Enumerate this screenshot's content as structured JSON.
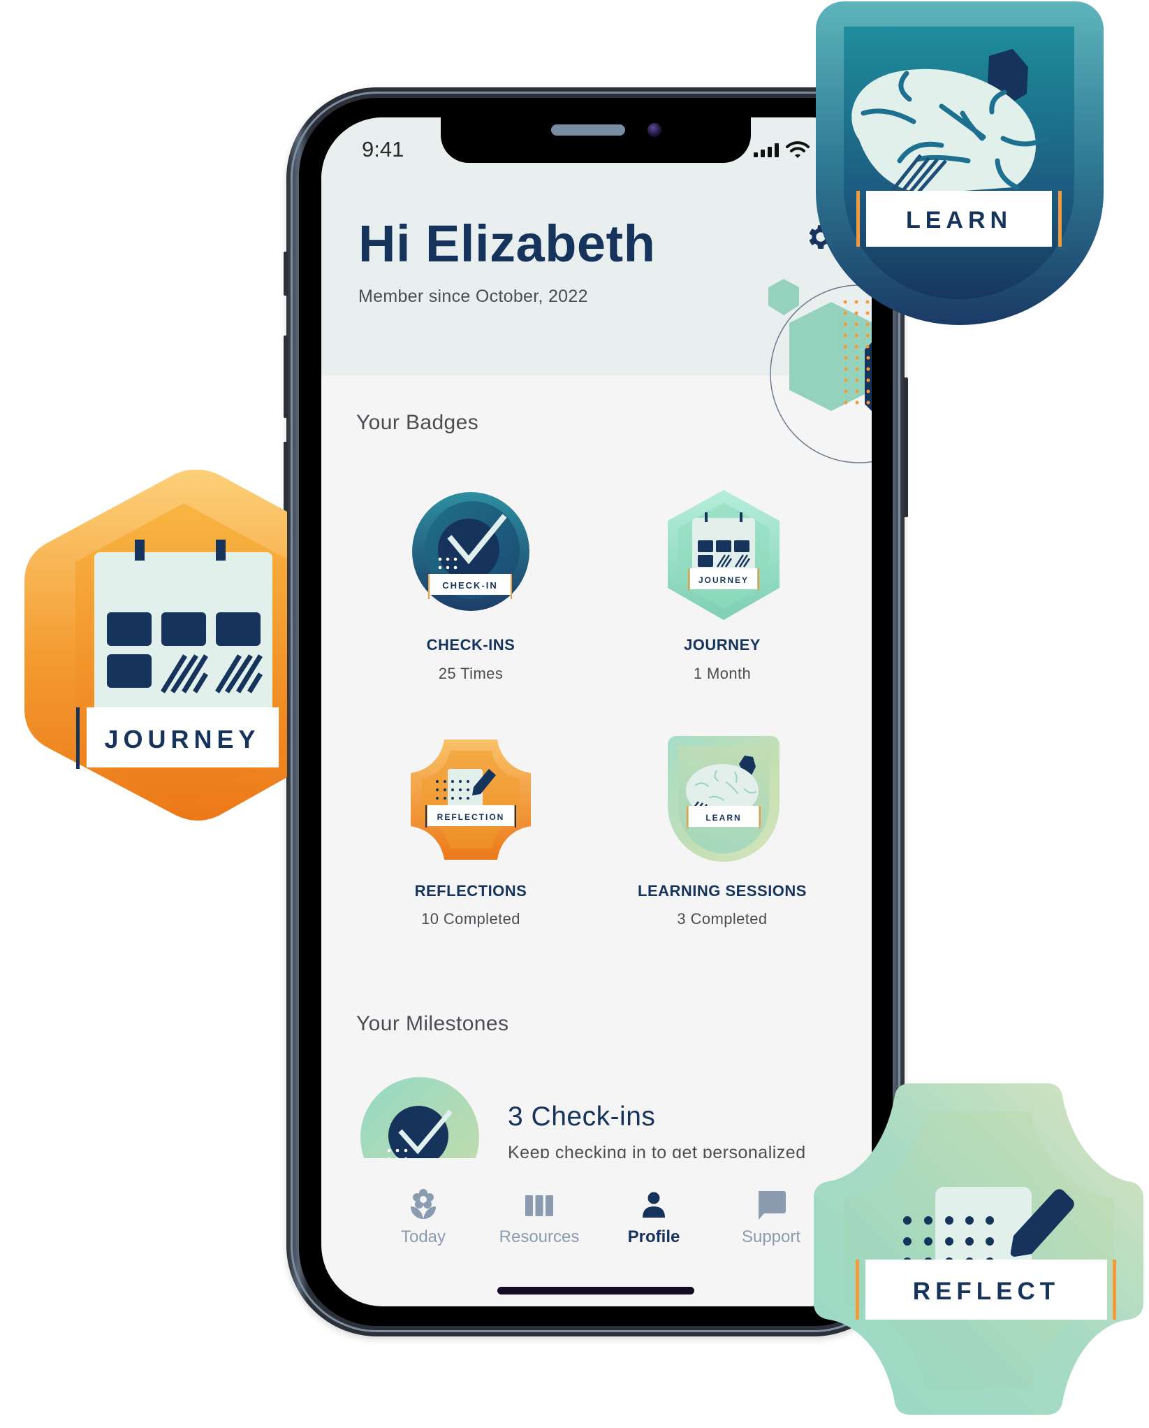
{
  "status_bar": {
    "time": "9:41"
  },
  "header": {
    "greeting": "Hi Elizabeth",
    "member_since": "Member since October, 2022",
    "settings_icon": "gear-icon"
  },
  "badges_section": {
    "title": "Your Badges",
    "items": [
      {
        "name": "CHECK-INS",
        "value": "25 Times",
        "emblem_label": "CHECK-IN",
        "icon": "check-badge-icon"
      },
      {
        "name": "JOURNEY",
        "value": "1 Month",
        "emblem_label": "JOURNEY",
        "icon": "calendar-badge-icon"
      },
      {
        "name": "REFLECTIONS",
        "value": "10 Completed",
        "emblem_label": "REFLECTION",
        "icon": "reflection-badge-icon"
      },
      {
        "name": "LEARNING SESSIONS",
        "value": "3 Completed",
        "emblem_label": "LEARN",
        "icon": "brain-badge-icon"
      }
    ]
  },
  "milestones_section": {
    "title": "Your Milestones",
    "items": [
      {
        "title": "3 Check-ins",
        "description": "Keep checking in to get personalized"
      }
    ]
  },
  "tab_bar": {
    "items": [
      {
        "label": "Today",
        "icon": "flower-icon",
        "active": false
      },
      {
        "label": "Resources",
        "icon": "books-icon",
        "active": false
      },
      {
        "label": "Profile",
        "icon": "person-icon",
        "active": true
      },
      {
        "label": "Support",
        "icon": "chat-bubble-icon",
        "active": false
      }
    ]
  },
  "floating_badges": {
    "learn": "LEARN",
    "journey": "JOURNEY",
    "reflect": "REFLECT"
  },
  "colors": {
    "navy": "#16335c",
    "teal": "#1e8a9a",
    "orange": "#f0a030",
    "mint": "#9fdcc6",
    "tab_inactive": "#8b9bb0"
  }
}
